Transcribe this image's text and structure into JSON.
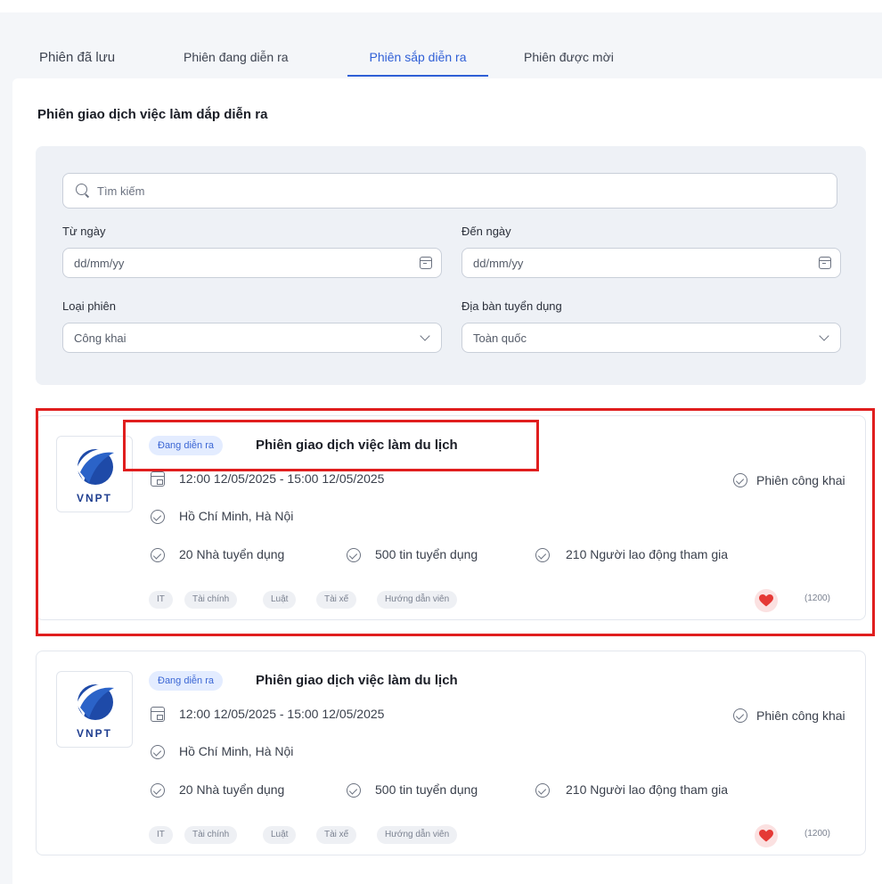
{
  "tabs": [
    {
      "label": "Phiên đã lưu",
      "active": false
    },
    {
      "label": "Phiên đang diễn ra",
      "active": false
    },
    {
      "label": "Phiên sắp diễn ra",
      "active": true
    },
    {
      "label": "Phiên được mời",
      "active": false
    }
  ],
  "section_title": "Phiên giao dịch việc làm dắp diễn ra",
  "filters": {
    "search_placeholder": "Tìm kiếm",
    "from_date_label": "Từ ngày",
    "from_date_placeholder": "dd/mm/yy",
    "to_date_label": "Đến ngày",
    "to_date_placeholder": "dd/mm/yy",
    "session_type_label": "Loại phiên",
    "session_type_value": "Công khai",
    "region_label": "Địa bàn tuyển dụng",
    "region_value": "Toàn quốc"
  },
  "cards": [
    {
      "logo_text": "VNPT",
      "status": "Đang diễn ra",
      "title": "Phiên giao dịch việc làm du lịch",
      "datetime": "12:00 12/05/2025 - 15:00  12/05/2025",
      "visibility": "Phiên công khai",
      "location": "Hồ Chí Minh, Hà Nội",
      "employers": "20 Nhà tuyển dụng",
      "jobs": "500 tin tuyển dụng",
      "workers": "210 Người lao động tham gia",
      "tags": [
        "IT",
        "Tài chính",
        "Luật",
        "Tài xế",
        "Hướng dẫn viên"
      ],
      "likes": "(1200)"
    },
    {
      "logo_text": "VNPT",
      "status": "Đang diễn ra",
      "title": "Phiên giao dịch việc làm du lịch",
      "datetime": "12:00 12/05/2025 - 15:00  12/05/2025",
      "visibility": "Phiên công khai",
      "location": "Hồ Chí Minh, Hà Nội",
      "employers": "20 Nhà tuyển dụng",
      "jobs": "500 tin tuyển dụng",
      "workers": "210 Người lao động tham gia",
      "tags": [
        "IT",
        "Tài chính",
        "Luật",
        "Tài xế",
        "Hướng dẫn viên"
      ],
      "likes": "(1200)"
    }
  ],
  "colors": {
    "accent": "#2f5fd6",
    "highlight": "#e01e1e",
    "logo_blue": "#1e3d8f",
    "heart": "#e53935"
  }
}
